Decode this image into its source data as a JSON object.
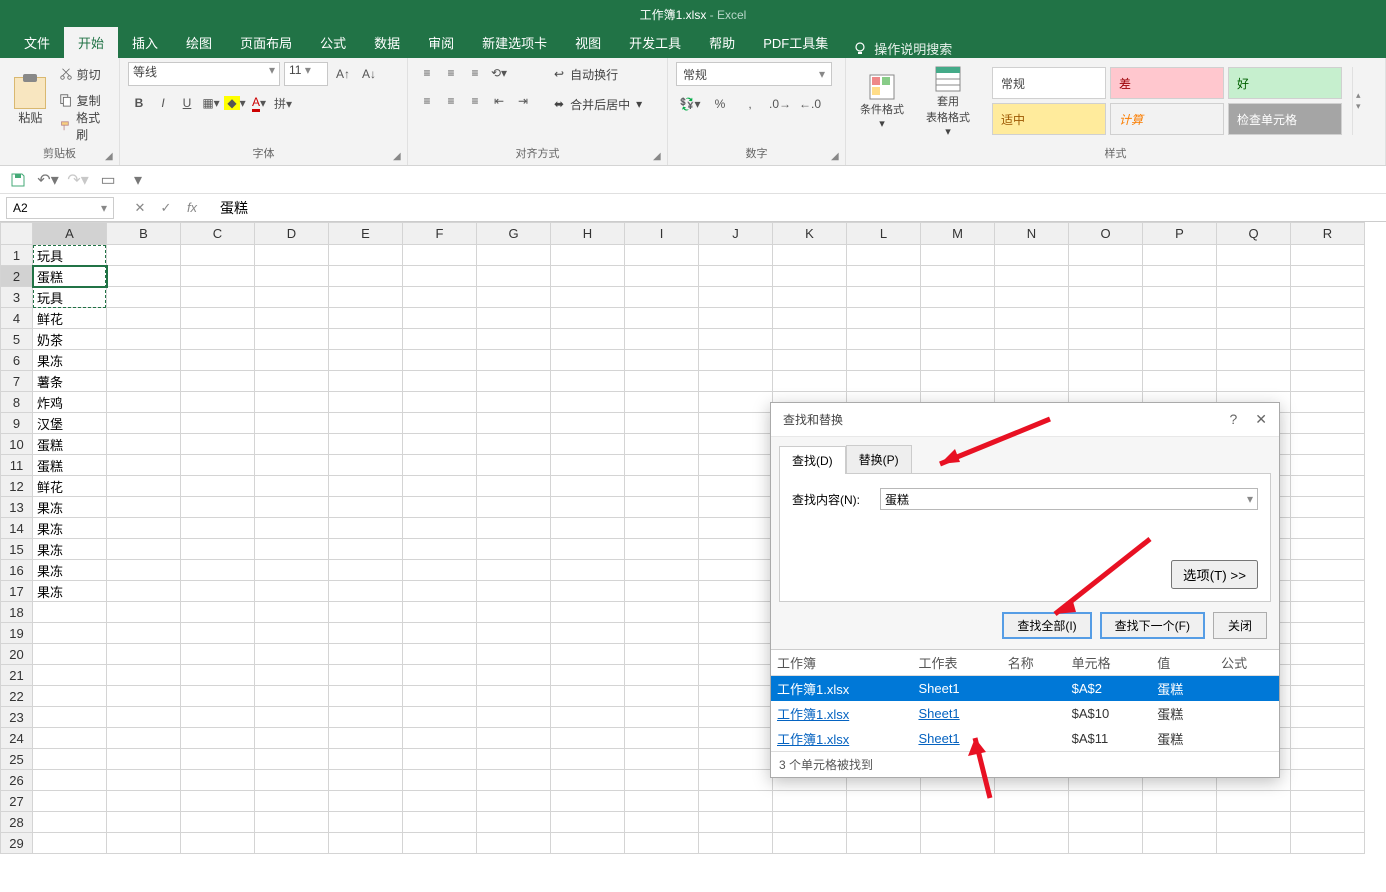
{
  "title": {
    "doc": "工作簿1.xlsx",
    "sep": " - ",
    "app": "Excel"
  },
  "tabs": {
    "file": "文件",
    "home": "开始",
    "insert": "插入",
    "draw": "绘图",
    "layout": "页面布局",
    "formulas": "公式",
    "data": "数据",
    "review": "审阅",
    "newtab": "新建选项卡",
    "view": "视图",
    "developer": "开发工具",
    "help": "帮助",
    "pdf": "PDF工具集",
    "tellme": "操作说明搜索"
  },
  "ribbon": {
    "clipboard": {
      "paste": "粘贴",
      "cut": "剪切",
      "copy": "复制",
      "fmtpainter": "格式刷",
      "label": "剪贴板"
    },
    "font": {
      "name": "等线",
      "size": "11",
      "label": "字体"
    },
    "align": {
      "wrap": "自动换行",
      "merge": "合并后居中",
      "label": "对齐方式"
    },
    "number": {
      "format": "常规",
      "label": "数字"
    },
    "styles": {
      "condfmt": "条件格式",
      "fmttable": "套用\n表格格式",
      "normal": "常规",
      "bad": "差",
      "good": "好",
      "neutral": "适中",
      "calc": "计算",
      "check": "检查单元格",
      "label": "样式"
    }
  },
  "namebox": "A2",
  "fx_value": "蛋糕",
  "columns": [
    "A",
    "B",
    "C",
    "D",
    "E",
    "F",
    "G",
    "H",
    "I",
    "J",
    "K",
    "L",
    "M",
    "N",
    "O",
    "P",
    "Q",
    "R"
  ],
  "rows": [
    "玩具",
    "蛋糕",
    "玩具",
    "鲜花",
    "奶茶",
    "果冻",
    "薯条",
    "炸鸡",
    "汉堡",
    "蛋糕",
    "蛋糕",
    "鲜花",
    "果冻",
    "果冻",
    "果冻",
    "果冻",
    "果冻",
    "",
    "",
    "",
    "",
    "",
    "",
    "",
    "",
    "",
    "",
    "",
    ""
  ],
  "dialog": {
    "title": "查找和替换",
    "tab_find": "查找(D)",
    "tab_replace": "替换(P)",
    "find_label": "查找内容(N):",
    "find_value": "蛋糕",
    "options": "选项(T) >>",
    "btn_findall": "查找全部(I)",
    "btn_findnext": "查找下一个(F)",
    "btn_close": "关闭",
    "cols": {
      "book": "工作簿",
      "sheet": "工作表",
      "name": "名称",
      "cell": "单元格",
      "value": "值",
      "formula": "公式"
    },
    "results": [
      {
        "book": "工作簿1.xlsx",
        "sheet": "Sheet1",
        "cell": "$A$2",
        "value": "蛋糕",
        "selected": true
      },
      {
        "book": "工作簿1.xlsx",
        "sheet": "Sheet1",
        "cell": "$A$10",
        "value": "蛋糕",
        "selected": false
      },
      {
        "book": "工作簿1.xlsx",
        "sheet": "Sheet1",
        "cell": "$A$11",
        "value": "蛋糕",
        "selected": false
      }
    ],
    "status": "3 个单元格被找到"
  }
}
